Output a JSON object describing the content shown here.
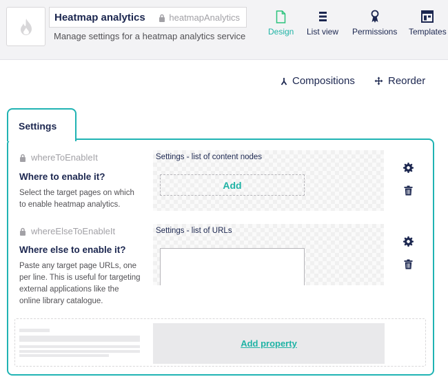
{
  "header": {
    "name": "Heatmap analytics",
    "alias": "heatmapAnalytics",
    "description": "Manage settings for a heatmap analytics service",
    "icon": "flame-icon"
  },
  "nav": [
    {
      "label": "Design",
      "icon": "document-icon",
      "active": true
    },
    {
      "label": "List view",
      "icon": "list-icon",
      "active": false
    },
    {
      "label": "Permissions",
      "icon": "medal-icon",
      "active": false
    },
    {
      "label": "Templates",
      "icon": "template-icon",
      "active": false
    }
  ],
  "actions": {
    "compositions": "Compositions",
    "reorder": "Reorder"
  },
  "group": {
    "tab_label": "Settings"
  },
  "properties": [
    {
      "alias": "whereToEnableIt",
      "label": "Where to enable it?",
      "description": "Select the target pages on which to enable heatmap analytics.",
      "editor_title": "Settings - list of content nodes",
      "editor_button": "Add"
    },
    {
      "alias": "whereElseToEnableIt",
      "label": "Where else to enable it?",
      "description": "Paste any target page URLs, one per line. This is useful for targeting external applications like the online library catalogue.",
      "editor_title": "Settings - list of URLs"
    }
  ],
  "add_property": "Add property",
  "colors": {
    "accent": "#1fb3b3",
    "text": "#1b264f",
    "active_nav": "#2bc37c"
  }
}
